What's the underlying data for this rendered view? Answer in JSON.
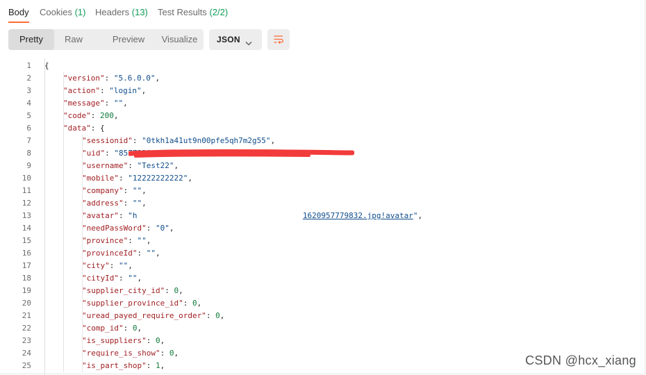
{
  "tabs": [
    {
      "label": "Body",
      "count": ""
    },
    {
      "label": "Cookies",
      "count": "(1)"
    },
    {
      "label": "Headers",
      "count": "(13)"
    },
    {
      "label": "Test Results",
      "count": "(2/2)"
    }
  ],
  "view_modes": [
    "Pretty",
    "Raw",
    "Preview",
    "Visualize"
  ],
  "format_select": "JSON",
  "code_lines": [
    {
      "n": "1",
      "d": 0,
      "parts": [
        [
          "p",
          "{"
        ]
      ]
    },
    {
      "n": "2",
      "d": 1,
      "parts": [
        [
          "k",
          "\"version\""
        ],
        [
          "p",
          ": "
        ],
        [
          "s",
          "\"5.6.0.0\""
        ],
        [
          "p",
          ","
        ]
      ]
    },
    {
      "n": "3",
      "d": 1,
      "parts": [
        [
          "k",
          "\"action\""
        ],
        [
          "p",
          ": "
        ],
        [
          "s",
          "\"login\""
        ],
        [
          "p",
          ","
        ]
      ]
    },
    {
      "n": "4",
      "d": 1,
      "parts": [
        [
          "k",
          "\"message\""
        ],
        [
          "p",
          ": "
        ],
        [
          "s",
          "\"\""
        ],
        [
          "p",
          ","
        ]
      ]
    },
    {
      "n": "5",
      "d": 1,
      "parts": [
        [
          "k",
          "\"code\""
        ],
        [
          "p",
          ": "
        ],
        [
          "n",
          "200"
        ],
        [
          "p",
          ","
        ]
      ]
    },
    {
      "n": "6",
      "d": 1,
      "parts": [
        [
          "k",
          "\"data\""
        ],
        [
          "p",
          ": {"
        ]
      ]
    },
    {
      "n": "7",
      "d": 2,
      "parts": [
        [
          "k",
          "\"sessionid\""
        ],
        [
          "p",
          ": "
        ],
        [
          "s",
          "\"0tkh1a41ut9n00pfe5qh7m2g55\""
        ],
        [
          "p",
          ","
        ]
      ]
    },
    {
      "n": "8",
      "d": 2,
      "parts": [
        [
          "k",
          "\"uid\""
        ],
        [
          "p",
          ": "
        ],
        [
          "s",
          "\"857732\""
        ],
        [
          "p",
          ","
        ]
      ]
    },
    {
      "n": "9",
      "d": 2,
      "parts": [
        [
          "k",
          "\"username\""
        ],
        [
          "p",
          ": "
        ],
        [
          "s",
          "\"Test22\""
        ],
        [
          "p",
          ","
        ]
      ]
    },
    {
      "n": "10",
      "d": 2,
      "parts": [
        [
          "k",
          "\"mobile\""
        ],
        [
          "p",
          ": "
        ],
        [
          "s",
          "\"12222222222\""
        ],
        [
          "p",
          ","
        ]
      ]
    },
    {
      "n": "11",
      "d": 2,
      "parts": [
        [
          "k",
          "\"company\""
        ],
        [
          "p",
          ": "
        ],
        [
          "s",
          "\"\""
        ],
        [
          "p",
          ","
        ]
      ]
    },
    {
      "n": "12",
      "d": 2,
      "parts": [
        [
          "k",
          "\"address\""
        ],
        [
          "p",
          ": "
        ],
        [
          "s",
          "\"\""
        ],
        [
          "p",
          ","
        ]
      ]
    },
    {
      "n": "13",
      "d": 2,
      "parts": [
        [
          "k",
          "\"avatar\""
        ],
        [
          "p",
          ": "
        ],
        [
          "s",
          "\"h"
        ],
        [
          "pad",
          "                                    "
        ],
        [
          "sl",
          "1620957779832.jpg!avatar"
        ],
        [
          "s",
          "\""
        ],
        [
          "p",
          ","
        ]
      ]
    },
    {
      "n": "14",
      "d": 2,
      "parts": [
        [
          "k",
          "\"needPassWord\""
        ],
        [
          "p",
          ": "
        ],
        [
          "s",
          "\"0\""
        ],
        [
          "p",
          ","
        ]
      ]
    },
    {
      "n": "15",
      "d": 2,
      "parts": [
        [
          "k",
          "\"province\""
        ],
        [
          "p",
          ": "
        ],
        [
          "s",
          "\"\""
        ],
        [
          "p",
          ","
        ]
      ]
    },
    {
      "n": "16",
      "d": 2,
      "parts": [
        [
          "k",
          "\"provinceId\""
        ],
        [
          "p",
          ": "
        ],
        [
          "s",
          "\"\""
        ],
        [
          "p",
          ","
        ]
      ]
    },
    {
      "n": "17",
      "d": 2,
      "parts": [
        [
          "k",
          "\"city\""
        ],
        [
          "p",
          ": "
        ],
        [
          "s",
          "\"\""
        ],
        [
          "p",
          ","
        ]
      ]
    },
    {
      "n": "18",
      "d": 2,
      "parts": [
        [
          "k",
          "\"cityId\""
        ],
        [
          "p",
          ": "
        ],
        [
          "s",
          "\"\""
        ],
        [
          "p",
          ","
        ]
      ]
    },
    {
      "n": "19",
      "d": 2,
      "parts": [
        [
          "k",
          "\"supplier_city_id\""
        ],
        [
          "p",
          ": "
        ],
        [
          "n",
          "0"
        ],
        [
          "p",
          ","
        ]
      ]
    },
    {
      "n": "20",
      "d": 2,
      "parts": [
        [
          "k",
          "\"supplier_province_id\""
        ],
        [
          "p",
          ": "
        ],
        [
          "n",
          "0"
        ],
        [
          "p",
          ","
        ]
      ]
    },
    {
      "n": "21",
      "d": 2,
      "parts": [
        [
          "k",
          "\"uread_payed_require_order\""
        ],
        [
          "p",
          ": "
        ],
        [
          "n",
          "0"
        ],
        [
          "p",
          ","
        ]
      ]
    },
    {
      "n": "22",
      "d": 2,
      "parts": [
        [
          "k",
          "\"comp_id\""
        ],
        [
          "p",
          ": "
        ],
        [
          "n",
          "0"
        ],
        [
          "p",
          ","
        ]
      ]
    },
    {
      "n": "23",
      "d": 2,
      "parts": [
        [
          "k",
          "\"is_suppliers\""
        ],
        [
          "p",
          ": "
        ],
        [
          "n",
          "0"
        ],
        [
          "p",
          ","
        ]
      ]
    },
    {
      "n": "24",
      "d": 2,
      "parts": [
        [
          "k",
          "\"require_is_show\""
        ],
        [
          "p",
          ": "
        ],
        [
          "n",
          "0"
        ],
        [
          "p",
          ","
        ]
      ]
    },
    {
      "n": "25",
      "d": 2,
      "parts": [
        [
          "k",
          "\"is_part_shop\""
        ],
        [
          "p",
          ": "
        ],
        [
          "n",
          "1"
        ],
        [
          "p",
          ","
        ]
      ]
    }
  ],
  "watermark": "CSDN @hcx_xiang",
  "colors": {
    "accent": "#ff6c37",
    "key": "#a11f23",
    "string": "#0f4c8a",
    "number": "#0f7a3a",
    "redaction": "#f23b3b"
  }
}
